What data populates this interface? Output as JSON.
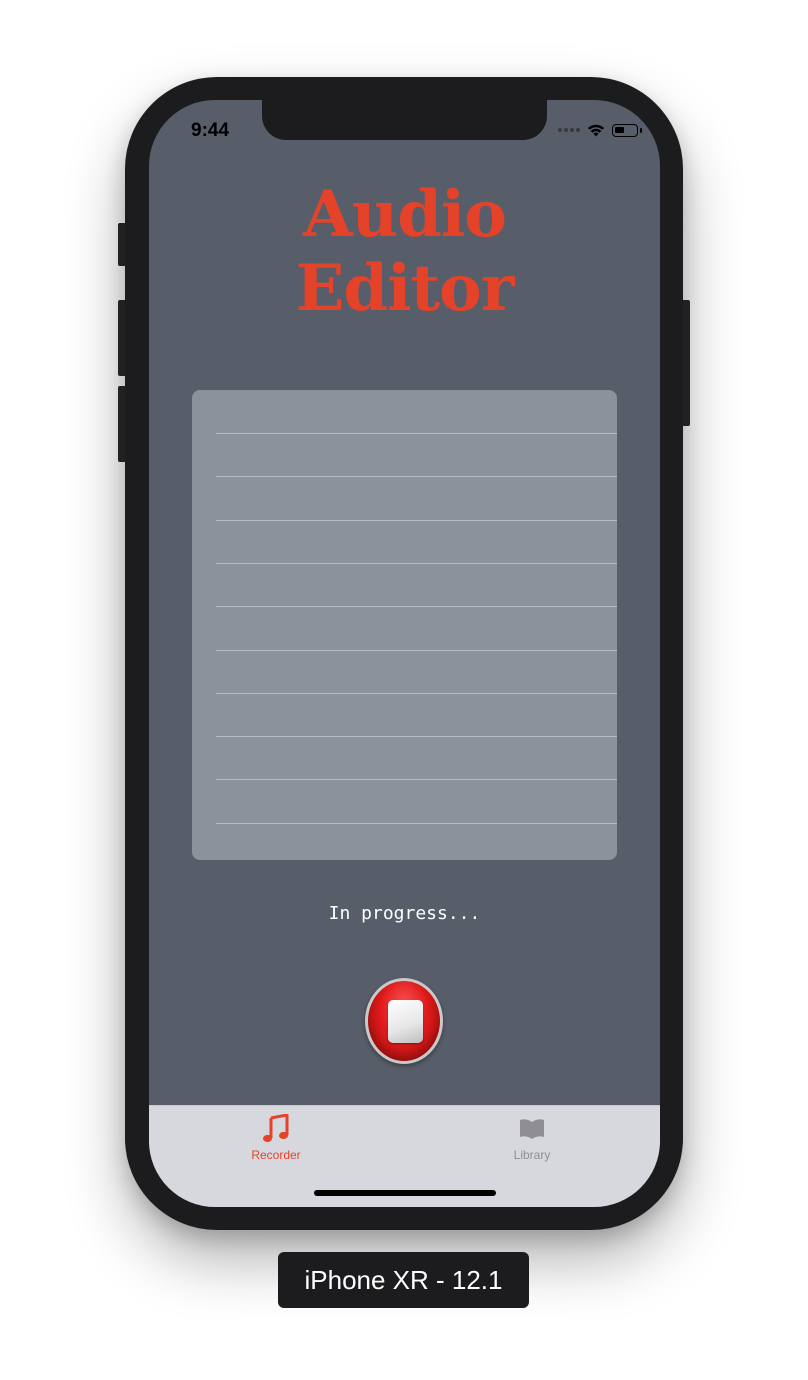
{
  "device": {
    "caption": "iPhone XR - 12.1"
  },
  "status_bar": {
    "time": "9:44",
    "icons": [
      "signal-dots-icon",
      "wifi-icon",
      "battery-icon"
    ]
  },
  "app": {
    "title_line1": "Audio",
    "title_line2": "Editor",
    "status_text": "In progress...",
    "stop_button_icon": "stop-icon",
    "list_rows": [
      "",
      "",
      "",
      "",
      "",
      "",
      "",
      "",
      "",
      ""
    ]
  },
  "tab_bar": {
    "tabs": [
      {
        "label": "Recorder",
        "icon": "music-note-icon",
        "selected": true
      },
      {
        "label": "Library",
        "icon": "book-icon",
        "selected": false
      }
    ]
  },
  "colors": {
    "accent": "#e4432a",
    "background": "#575d69",
    "panel": "#8c929c",
    "tab_bar": "#d6d8de",
    "inactive_tab": "#8e8e93"
  }
}
